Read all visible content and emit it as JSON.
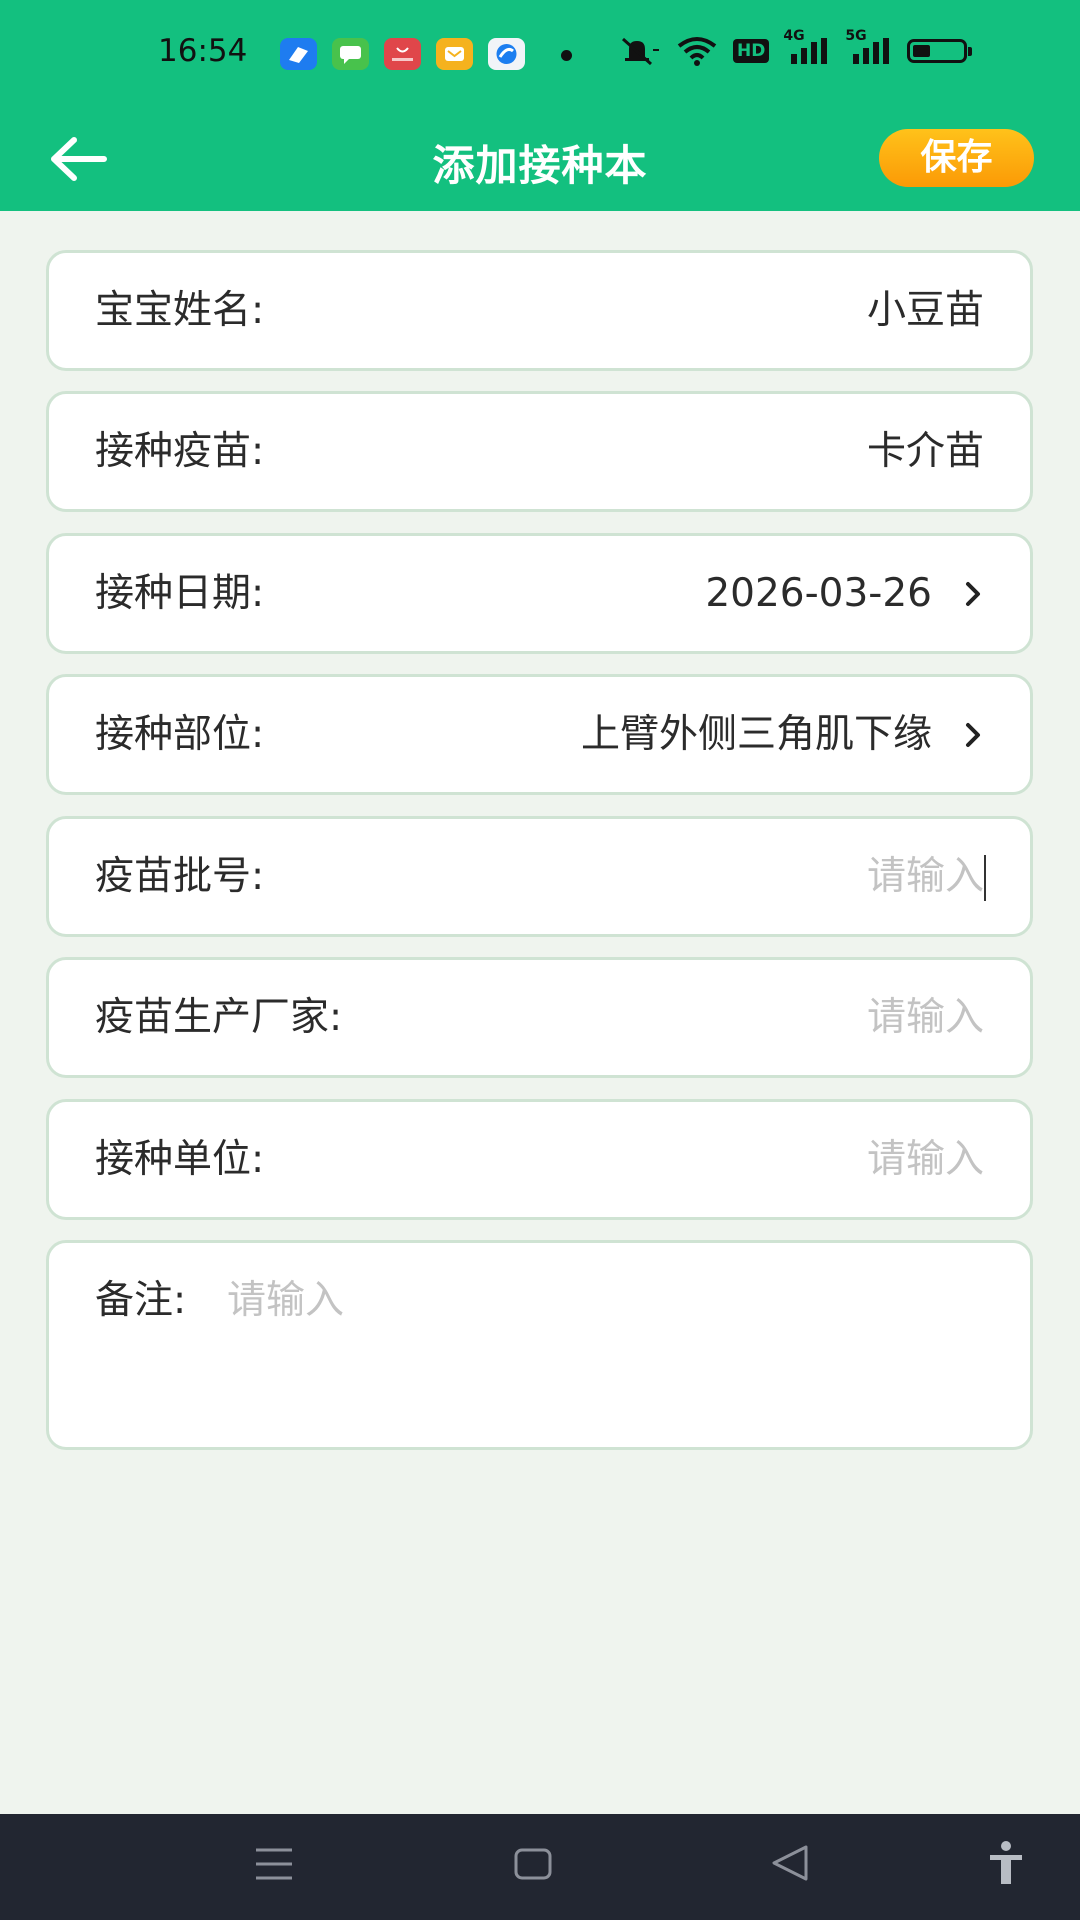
{
  "status_bar": {
    "time": "16:54",
    "network_badge": "HD",
    "signal_1": "4G",
    "signal_2": "5G",
    "battery_level": 0.35,
    "notif_icons": [
      "feishu-icon",
      "messages-icon",
      "huawei-store-icon",
      "wallet-icon",
      "browser-icon"
    ]
  },
  "header": {
    "title": "添加接种本",
    "save_label": "保存"
  },
  "form": {
    "baby_name": {
      "label": "宝宝姓名:",
      "value": "小豆苗"
    },
    "vaccine": {
      "label": "接种疫苗:",
      "value": "卡介苗"
    },
    "date": {
      "label": "接种日期:",
      "value": "2026-03-26"
    },
    "site": {
      "label": "接种部位:",
      "value": "上臂外侧三角肌下缘"
    },
    "batch": {
      "label": "疫苗批号:",
      "placeholder": "请输入"
    },
    "manufacturer": {
      "label": "疫苗生产厂家:",
      "placeholder": "请输入"
    },
    "unit": {
      "label": "接种单位:",
      "placeholder": "请输入"
    },
    "remarks": {
      "label": "备注:",
      "placeholder": "请输入"
    }
  },
  "colors": {
    "header_bg": "#13c07f",
    "page_bg": "#eff4ee",
    "save_button": "#fb9a06",
    "card_border": "#cfe3d3",
    "nav_bar": "#222631"
  }
}
